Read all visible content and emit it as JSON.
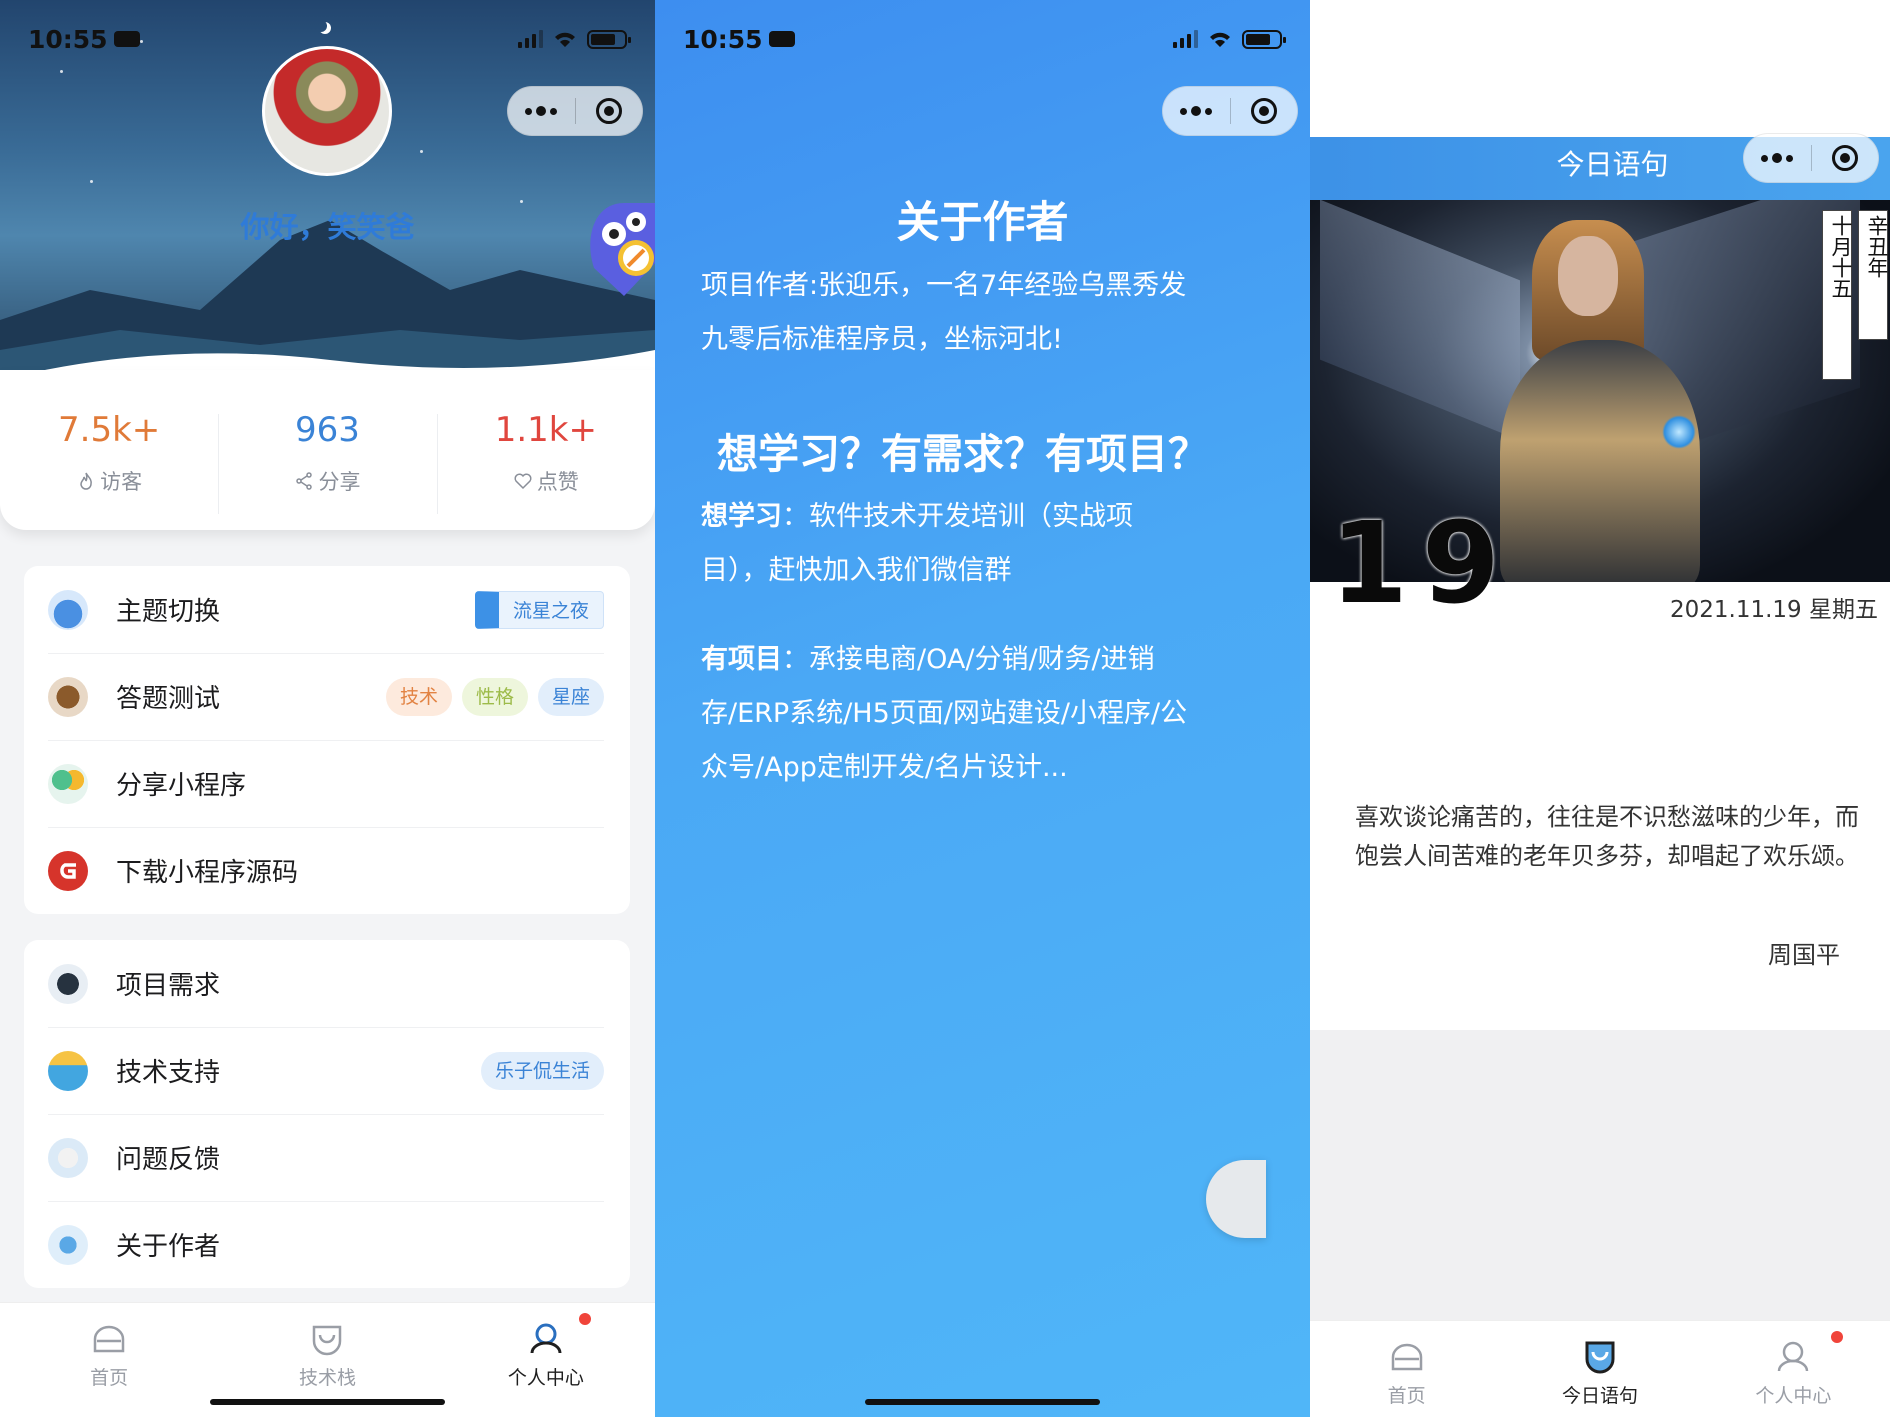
{
  "status": {
    "time": "10:55"
  },
  "profile": {
    "greeting": "你好，笑笑爸",
    "stats": [
      {
        "value": "7.5k+",
        "label": "访客",
        "color": "#e07a38"
      },
      {
        "value": "963",
        "label": "分享",
        "color": "#3a83d6"
      },
      {
        "value": "1.1k+",
        "label": "点赞",
        "color": "#e0463e"
      }
    ],
    "menu1": [
      {
        "label": "主题切换",
        "tags": [
          "流星之夜"
        ]
      },
      {
        "label": "答题测试",
        "tags": [
          "技术",
          "性格",
          "星座"
        ]
      },
      {
        "label": "分享小程序",
        "tags": []
      },
      {
        "label": "下载小程序源码",
        "tags": []
      }
    ],
    "menu2": [
      {
        "label": "项目需求",
        "tags": []
      },
      {
        "label": "技术支持",
        "tags": [
          "乐子侃生活"
        ]
      },
      {
        "label": "问题反馈",
        "tags": []
      },
      {
        "label": "关于作者",
        "tags": []
      }
    ],
    "tabbar": [
      "首页",
      "技术栈",
      "个人中心"
    ]
  },
  "about": {
    "title": "关于作者",
    "line1": "项目作者:张迎乐，一名7年经验乌黑秀发",
    "line2": "九零后标准程序员，坐标河北!",
    "heading": "想学习？有需求？有项目？",
    "learn_label": "想学习",
    "learn_line1": "：软件技术开发培训（实战项",
    "learn_line2": "目），赶快加入我们微信群",
    "project_label": "有项目",
    "project_line1": "：承接电商/OA/分销/财务/进销",
    "project_line2": "存/ERP系统/H5页面/网站建设/小程序/公",
    "project_line3": "众号/App定制开发/名片设计..."
  },
  "daily": {
    "nav_title": "今日语句",
    "lunar_day": "十月十五",
    "lunar_year": "辛丑年",
    "day": "19",
    "date": "2021.11.19 星期五",
    "quote": "喜欢谈论痛苦的，往往是不识愁滋味的少年，而饱尝人间苦难的老年贝多芬，却唱起了欢乐颂。",
    "author": "周国平",
    "tabbar": [
      "首页",
      "今日语句",
      "个人中心"
    ]
  },
  "colors": {
    "accent_blue": "#3a83d6",
    "badge_red": "#f0443a"
  }
}
